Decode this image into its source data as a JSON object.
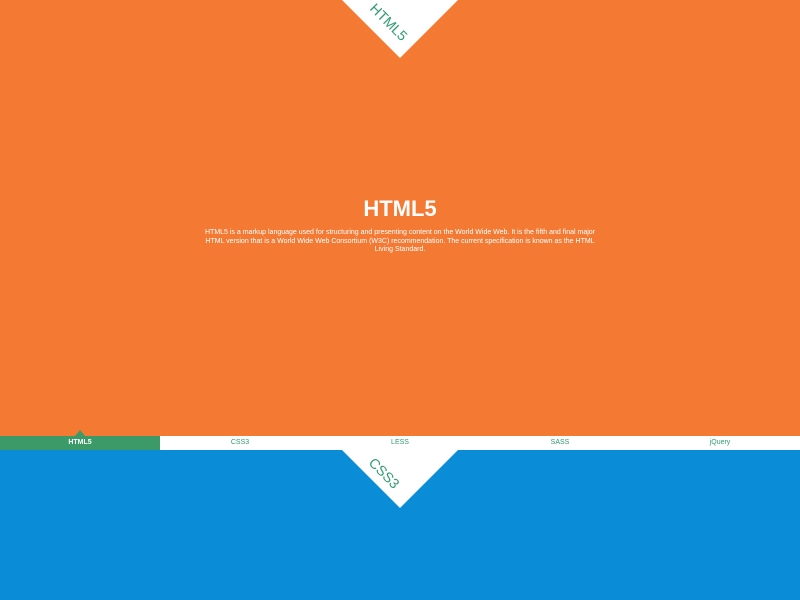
{
  "colors": {
    "top_section_bg": "#f47a34",
    "bottom_section_bg": "#0a8cd6",
    "nav_active_bg": "#3c9a68",
    "nav_text": "#2f9c6e",
    "white": "#ffffff"
  },
  "top_section": {
    "triangle_label": "HTML5",
    "title": "HTML5",
    "description": "HTML5 is a markup language used for structuring and presenting content on the World Wide Web. It is the fifth and final major HTML version that is a World Wide Web Consortium (W3C) recommendation. The current specification is known as the HTML Living Standard."
  },
  "navbar": {
    "items": [
      {
        "label": "HTML5",
        "active": true
      },
      {
        "label": "CSS3",
        "active": false
      },
      {
        "label": "LESS",
        "active": false
      },
      {
        "label": "SASS",
        "active": false
      },
      {
        "label": "jQuery",
        "active": false
      }
    ]
  },
  "bottom_section": {
    "triangle_label": "CSS3"
  }
}
